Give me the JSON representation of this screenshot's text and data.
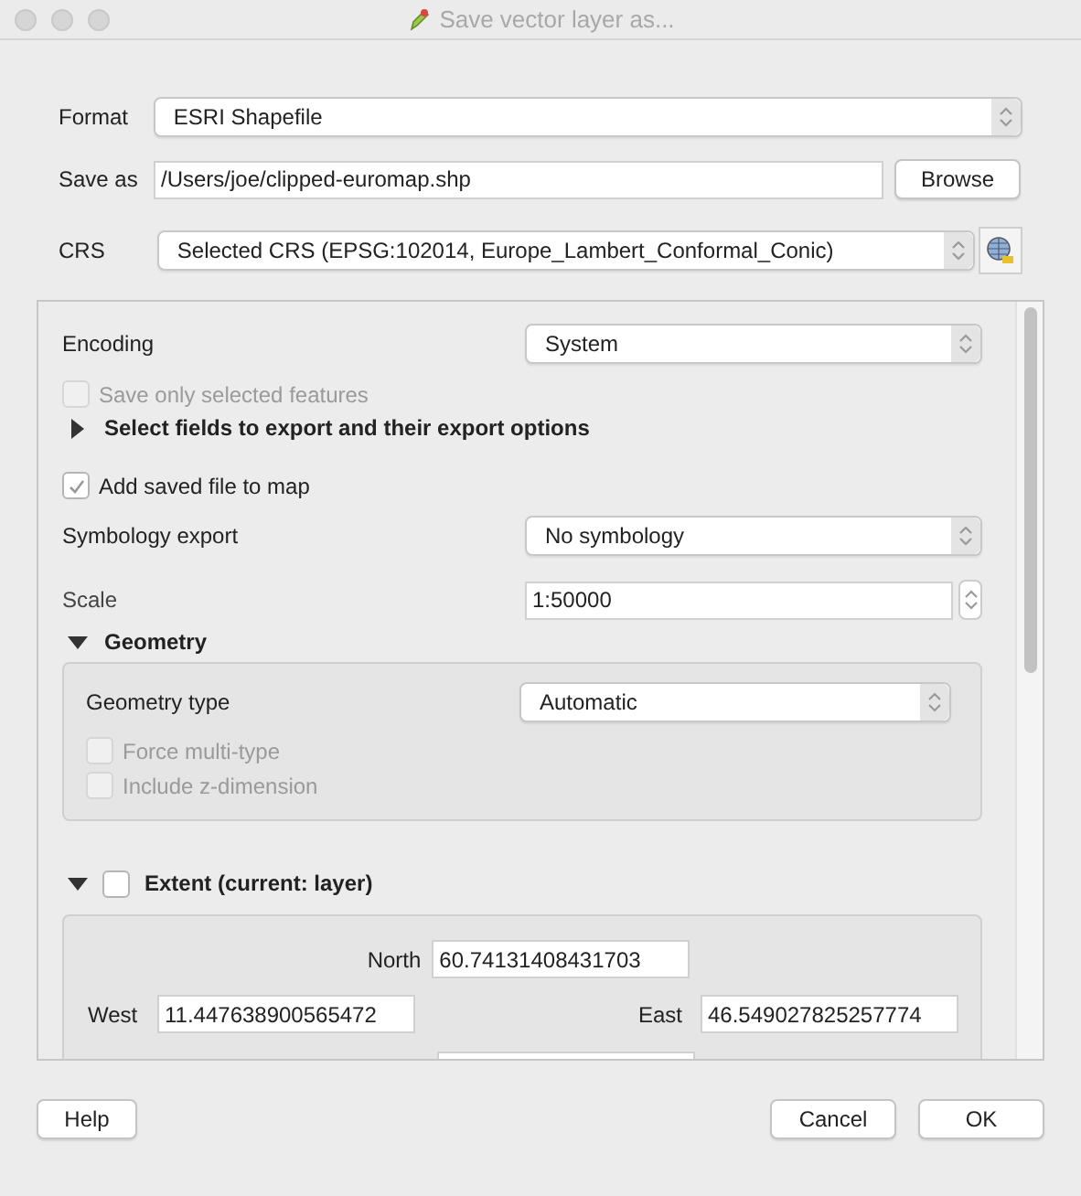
{
  "window": {
    "title": "Save vector layer as..."
  },
  "format": {
    "label": "Format",
    "value": "ESRI Shapefile"
  },
  "save_as": {
    "label": "Save as",
    "value": "/Users/joe/clipped-euromap.shp",
    "button": "Browse"
  },
  "crs": {
    "label": "CRS",
    "value": "Selected CRS (EPSG:102014, Europe_Lambert_Conformal_Conic)"
  },
  "options": {
    "encoding": {
      "label": "Encoding",
      "value": "System"
    },
    "save_only_selected": {
      "label": "Save only selected features",
      "checked": false,
      "disabled": true
    },
    "select_fields": {
      "label": "Select fields to export and their export options",
      "expanded": false
    },
    "add_to_map": {
      "label": "Add saved file to map",
      "checked": true,
      "disabled": false
    },
    "symbology": {
      "label": "Symbology export",
      "value": "No symbology"
    },
    "scale": {
      "label": "Scale",
      "value": "1:50000"
    }
  },
  "geometry": {
    "title": "Geometry",
    "expanded": true,
    "type_label": "Geometry type",
    "type_value": "Automatic",
    "checkboxes": [
      {
        "label": "Force multi-type",
        "checked": false,
        "disabled": true
      },
      {
        "label": "Include z-dimension",
        "checked": false,
        "disabled": true
      }
    ]
  },
  "extent": {
    "title": "Extent (current: layer)",
    "expanded": true,
    "checked": false,
    "north_label": "North",
    "north": "60.74131408431703",
    "west_label": "West",
    "west": "11.447638900565472",
    "east_label": "East",
    "east": "46.549027825257774"
  },
  "buttons": {
    "help": "Help",
    "cancel": "Cancel",
    "ok": "OK"
  }
}
